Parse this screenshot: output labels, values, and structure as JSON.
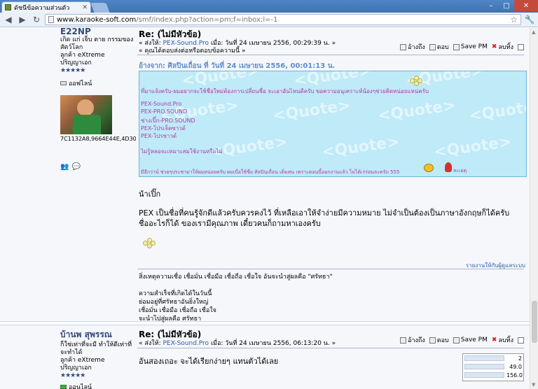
{
  "browser": {
    "tab_title": "ดัชนีข้อความส่วนตัว",
    "url_host": "www.karaoke-soft.com",
    "url_path": "/smf/index.php?action=pm;f=inbox;l=-1"
  },
  "post1": {
    "poster": {
      "name": "E22NP",
      "line1": "เกิด แก่ เจ็บ ตาย กรรมของ",
      "line2": "สัตว์โลก",
      "rank": "ลูกค้า eXtreme",
      "rank2": "ปริญญาเอก",
      "stars": "★★★★★",
      "status": "ออฟไลน์",
      "avatar_caption": "7C1132A8,9664E44E,4D30C"
    },
    "subject": "Re: (ไม่มีหัวข้อ)",
    "meta_prefix": "« ส่งให้:",
    "meta_to": "PEX-Sound.Pro",
    "meta_rest": "เมื่อ: วันที่ 24 เมษายน 2556, 00:29:39 น. »",
    "meta_sub": "« คุณได้ตอบส่งต่อหรือตอบข้อความนี้ »",
    "actions": {
      "quote": "อ้างถึง",
      "reply": "ตอบ",
      "save": "Save PM",
      "delete": "ลบทิ้ง"
    },
    "quote_header": "อ้างจาก: ศิลปินเถื่อน ที่ วันที่ 24 เมษายน  2556, 00:01:13 น.",
    "quote_watermark": "<Quote>",
    "quote_lines": [
      "ที่มาแจ้งครับ-ผมอยากจะใช้ชื่อใหม่ต้องการเปลี่ยนชื่อ จะเอาอันไหนดีครับ ขอความอนุเคราะห์น้องๆช่วยคิดหน่อยแหน่ครับ",
      "PEX-Sound.Pro",
      "PEX-PRO.SOUND",
      "ช่างเปิ๊ก-PRO.SOUND",
      "PEX-โปรเจ็คซาวด์",
      "PEX-โปรซาวด์",
      "ไม่รู้หลอจะเหมาะสมใช้งานหรือไม่",
      "มีอีกว่าน์ ช่วยๆประชามาให้ผมหน่อยครับ ผมเบื่อใช้ชื่อ ศิลปินเถื่อน เต็มทน เพราะตอนนี้ออกงานแล้ว ไม่ได้เร่ร่อนละครับ 555"
    ],
    "quote_girl_label": "ละเยตุ",
    "body_lines": [
      "น้าเปิ๊ก",
      "PEX เป็นชื่อที่คนรู้จักดีแล้วครับควรคงไว้ ที่เหลือเอาให้จำง่ายมีความหมาย ไม่จำเป็นต้องเป็นภาษาอังกฤษก็ได้ครับ",
      "ชื่ออะไรก็ได้ ของเรามีคุณภาพ เดี๋ยวคนก็ถามหาเองครับ"
    ],
    "report_link": "รายงานให้กับผู้ดูแลระบบ",
    "signature": [
      "สิ่งเหตุความเชื่อ เชื่อมั่น เชื่อมือ เชื่อถือ เชื่อใจ อันจะนำสู่ผลคือ \"ศรัทธา\"",
      "",
      "ความสำเร็จที่เกิดได้ในวันนี้",
      "ย่อมอยู่ที่ศรัทธาอันยิ่งใหญ่",
      "เชื่อมั่น เชื่อมือ เชื่อถือ เชื่อใจ",
      "จะนำไปสู่ผลคือ ศรัทธา"
    ]
  },
  "post2": {
    "poster": {
      "name": "บ้านพ สุพรรณ",
      "line1": "ก็ใช่เท่าที่จะมี ทำให้ดีเท่าที่",
      "line2": "จะทำได้",
      "rank": "ลูกค้า eXtreme",
      "rank2": "ปริญญาเอก",
      "stars": "★★★★★",
      "status": "ออนไลน์"
    },
    "subject": "Re: (ไม่มีหัวข้อ)",
    "meta_prefix": "« ส่งให้:",
    "meta_to": "PEX-Sound.Pro",
    "meta_rest": "เมื่อ: วันที่ 24 เมษายน 2556, 06:13:20 น. »",
    "actions": {
      "quote": "อ้างถึง",
      "reply": "ตอบ",
      "save": "Save PM",
      "delete": "ลบทิ้ง"
    },
    "body": "อันสองเถอะ  จะได้เรียกง่ายๆ  แทนตัวได้เลย",
    "stats": [
      "2",
      "49.0",
      "156.0"
    ]
  }
}
